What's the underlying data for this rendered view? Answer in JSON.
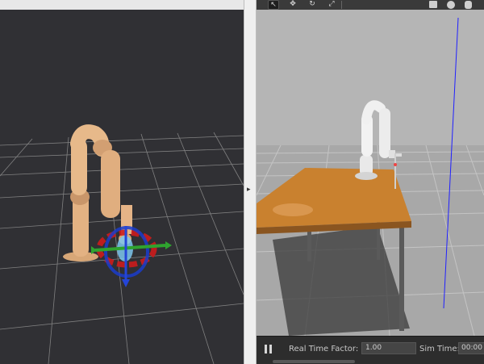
{
  "gazebo": {
    "toolbar": {
      "tools": [
        {
          "name": "select-tool-icon",
          "glyph": "↖"
        },
        {
          "name": "translate-tool-icon",
          "glyph": "✥"
        },
        {
          "name": "rotate-tool-icon",
          "glyph": "↻"
        },
        {
          "name": "scale-tool-icon",
          "glyph": "⤢"
        }
      ]
    },
    "bottom_bar": {
      "real_time_factor_label": "Real Time Factor:",
      "real_time_factor_value": "1.00",
      "sim_time_label": "Sim Time:",
      "sim_time_value": "00:00"
    }
  },
  "colors": {
    "rviz_background": "#303034",
    "grid_line": "#8a8a8a",
    "robot_arm": "#e7b98a",
    "gazebo_sky": "#b4b4b4",
    "table_top": "#c9812f",
    "axis_blue": "#2020ff"
  }
}
